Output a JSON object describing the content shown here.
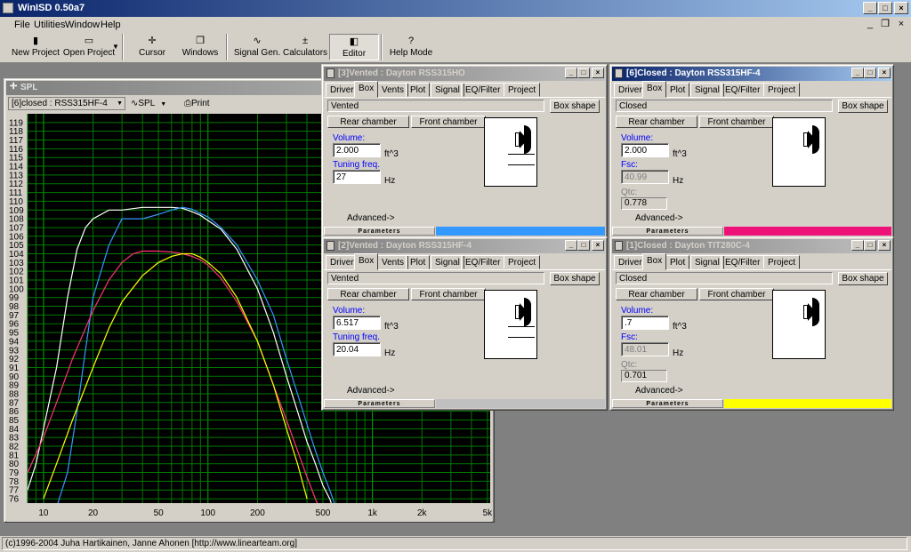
{
  "app": {
    "title": "WinISD 0.50a7"
  },
  "menu": [
    "File",
    "Utilities",
    "Window",
    "Help"
  ],
  "toolbar": [
    {
      "label": "New Project",
      "icon": "new-project-icon",
      "glyph": "▮"
    },
    {
      "label": "Open Project",
      "icon": "open-project-icon",
      "glyph": "📂"
    },
    {
      "label": "Cursor",
      "icon": "cursor-icon",
      "glyph": "✛"
    },
    {
      "label": "Windows",
      "icon": "windows-icon",
      "glyph": "❐"
    },
    {
      "label": "Signal Gen.",
      "icon": "signal-gen-icon",
      "glyph": "∿"
    },
    {
      "label": "Calculators",
      "icon": "calculators-icon",
      "glyph": "±"
    },
    {
      "label": "Editor",
      "icon": "editor-icon",
      "glyph": "◧"
    },
    {
      "label": "Help Mode",
      "icon": "help-icon",
      "glyph": "?"
    }
  ],
  "spl": {
    "title": "SPL",
    "project_select": "[6]closed : RSS315HF-4",
    "plot_select": "SPL",
    "print_label": "Print"
  },
  "chart_data": {
    "type": "line",
    "x_scale": "log",
    "xlim": [
      8,
      5200
    ],
    "ylim": [
      75.5,
      120
    ],
    "x_ticks": [
      "10",
      "20",
      "50",
      "100",
      "200",
      "500",
      "1k",
      "2k",
      "5k"
    ],
    "y_ticks": [
      "119",
      "118",
      "117",
      "116",
      "115",
      "114",
      "113",
      "112",
      "111",
      "110",
      "109",
      "108",
      "107",
      "106",
      "105",
      "104",
      "103",
      "102",
      "101",
      "100",
      "99",
      "98",
      "97",
      "96",
      "95",
      "94",
      "93",
      "92",
      "91",
      "90",
      "89",
      "88",
      "87",
      "86",
      "85",
      "84",
      "83",
      "82",
      "81",
      "80",
      "79",
      "78",
      "77",
      "76"
    ],
    "grid": true,
    "series": [
      {
        "color": "#ffffff",
        "x": [
          8,
          9,
          10,
          12,
          14,
          16,
          18,
          20,
          25,
          30,
          40,
          50,
          60,
          70,
          80,
          90,
          100,
          120,
          150,
          200,
          250,
          300,
          350,
          400,
          450,
          500,
          550,
          600,
          650
        ],
        "y": [
          77,
          80,
          84,
          91,
          99,
          104.5,
          107,
          108,
          109,
          109,
          109.3,
          109.3,
          109.3,
          109.2,
          108.8,
          108.4,
          107.8,
          106.8,
          104.5,
          100,
          95,
          90,
          86,
          82.5,
          80,
          77.5,
          76,
          74,
          72
        ]
      },
      {
        "color": "#3399ff",
        "x": [
          12,
          14,
          16,
          18,
          20,
          25,
          30,
          40,
          50,
          60,
          70,
          80,
          90,
          100,
          120,
          150,
          200,
          250,
          300,
          350,
          400,
          450,
          500,
          550,
          600,
          650,
          700
        ],
        "y": [
          75,
          79,
          86,
          93,
          99,
          105,
          108,
          108,
          108.5,
          109,
          109.3,
          109.1,
          108.6,
          108.2,
          107,
          105,
          101,
          97,
          92,
          88,
          84.5,
          81.5,
          79,
          77,
          75,
          73,
          72
        ]
      },
      {
        "color": "#ff3377",
        "x": [
          8,
          10,
          12,
          15,
          20,
          25,
          30,
          35,
          40,
          50,
          60,
          70,
          80,
          90,
          100,
          120,
          150,
          200,
          250,
          300,
          350,
          400,
          450,
          500
        ],
        "y": [
          79,
          83,
          87,
          92,
          97.5,
          101,
          103,
          104,
          104.3,
          104.3,
          104.2,
          104,
          103.7,
          103.3,
          102.7,
          101.2,
          98.5,
          94,
          89,
          85,
          81.5,
          78.5,
          76,
          74
        ]
      },
      {
        "color": "#ffff00",
        "x": [
          10,
          12,
          15,
          20,
          25,
          30,
          40,
          50,
          60,
          70,
          80,
          90,
          100,
          120,
          150,
          200,
          250,
          300,
          350,
          400
        ],
        "y": [
          76,
          80,
          85,
          91,
          95.5,
          98.5,
          101.5,
          103,
          103.7,
          104,
          104,
          103.6,
          103,
          101.7,
          99,
          94,
          89,
          84,
          80,
          76
        ]
      }
    ]
  },
  "windows": [
    {
      "id": "w3",
      "title": "[3]Vented : Dayton RSS315HO",
      "active": false,
      "shape": "vented",
      "tabs": [
        "Driver",
        "Box",
        "Vents",
        "Plot",
        "Signal",
        "EQ/Filter",
        "Project"
      ],
      "selected_tab": "Box",
      "box_type": "Vented",
      "box_shape_btn": "Box shape",
      "rear_btn": "Rear chamber",
      "front_btn": "Front chamber",
      "field1_label": "Volume:",
      "field1_value": "2.000",
      "unit1": "ft^3",
      "field2_label": "Tuning freq.",
      "field2_value": "27",
      "unit2": "Hz",
      "field3_label": "",
      "field3_value": "",
      "advanced": "Advanced->",
      "params": "Parameters",
      "color": "#3399ff"
    },
    {
      "id": "w6",
      "title": "[6]Closed : Dayton RSS315HF-4",
      "active": true,
      "shape": "closed",
      "tabs": [
        "Driver",
        "Box",
        "Plot",
        "Signal",
        "EQ/Filter",
        "Project"
      ],
      "selected_tab": "Box",
      "box_type": "Closed",
      "box_shape_btn": "Box shape",
      "rear_btn": "Rear chamber",
      "front_btn": "Front chamber",
      "field1_label": "Volume:",
      "field1_value": "2.000",
      "unit1": "ft^3",
      "field2_label": "Fsc:",
      "field2_value": "40.99",
      "unit2": "Hz",
      "field3_label": "Qtc:",
      "field3_value": "0.778",
      "advanced": "Advanced->",
      "params": "Parameters",
      "color": "#ee1177"
    },
    {
      "id": "w2",
      "title": "[2]Vented : Dayton RSS315HF-4",
      "active": false,
      "shape": "vented",
      "tabs": [
        "Driver",
        "Box",
        "Vents",
        "Plot",
        "Signal",
        "EQ/Filter",
        "Project"
      ],
      "selected_tab": "Box",
      "box_type": "Vented",
      "box_shape_btn": "Box shape",
      "rear_btn": "Rear chamber",
      "front_btn": "Front chamber",
      "field1_label": "Volume:",
      "field1_value": "6.517",
      "unit1": "ft^3",
      "field2_label": "Tuning freq.",
      "field2_value": "20.04",
      "unit2": "Hz",
      "field3_label": "",
      "field3_value": "",
      "advanced": "Advanced->",
      "params": "Parameters",
      "color": "#c0c0c0"
    },
    {
      "id": "w1",
      "title": "[1]Closed : Dayton TIT280C-4",
      "active": false,
      "shape": "closed",
      "tabs": [
        "Driver",
        "Box",
        "Plot",
        "Signal",
        "EQ/Filter",
        "Project"
      ],
      "selected_tab": "Box",
      "box_type": "Closed",
      "box_shape_btn": "Box shape",
      "rear_btn": "Rear chamber",
      "front_btn": "Front chamber",
      "field1_label": "Volume:",
      "field1_value": ".7",
      "unit1": "ft^3",
      "field2_label": "Fsc:",
      "field2_value": "48.01",
      "unit2": "Hz",
      "field3_label": "Qtc:",
      "field3_value": "0.701",
      "advanced": "Advanced->",
      "params": "Parameters",
      "color": "#ffff00"
    }
  ],
  "status": "(c)1996-2004 Juha Hartikainen, Janne Ahonen [http://www.linearteam.org]"
}
